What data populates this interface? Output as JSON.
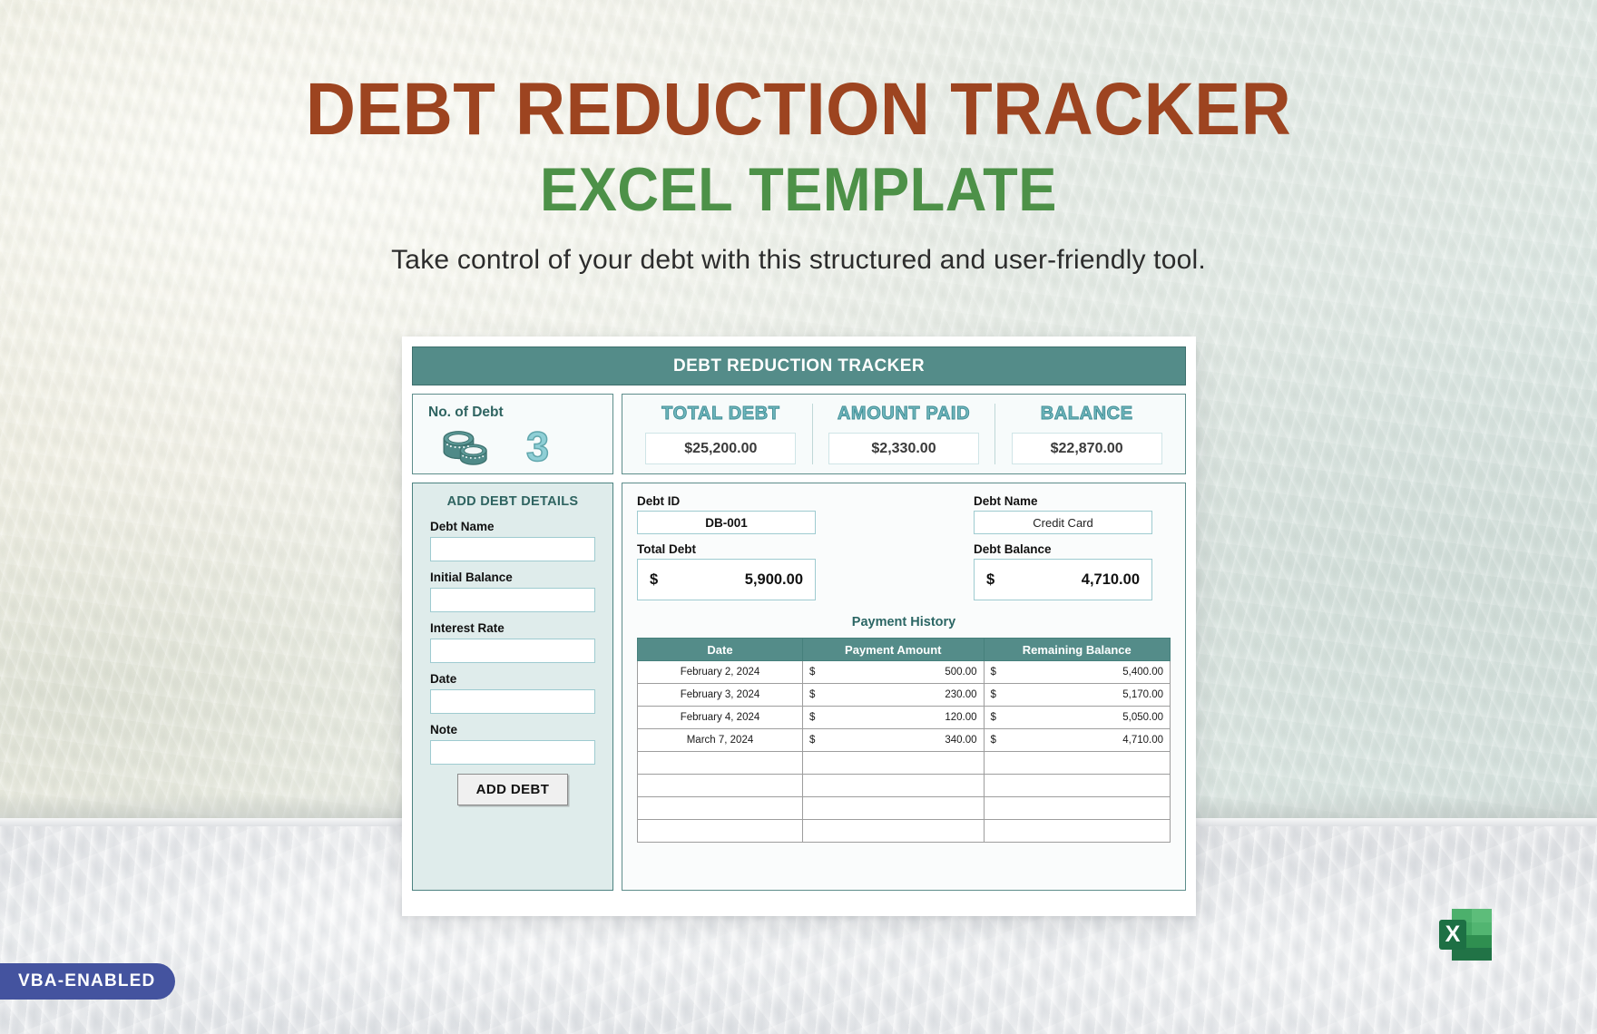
{
  "poster": {
    "title_line1": "DEBT REDUCTION TRACKER",
    "title_line2": "EXCEL TEMPLATE",
    "tagline": "Take control of your debt with this structured and user-friendly tool.",
    "vba_badge": "VBA-ENABLED",
    "colors": {
      "title_main": "#9d4420",
      "title_sub": "#4d9148",
      "sheet_header_teal": "#548c89",
      "panel_fill_light": "#f7fbfb",
      "form_panel_fill": "#dfeceb",
      "kpi_label_teal": "#6fb6bd",
      "badge_blue": "#44539f",
      "excel_green": "#217346"
    }
  },
  "sheet": {
    "header_title": "DEBT REDUCTION TRACKER",
    "count_panel": {
      "label": "No. of Debt",
      "icon": "coin-stack-icon",
      "value": "3"
    },
    "kpis": [
      {
        "label": "TOTAL DEBT",
        "value": "$25,200.00"
      },
      {
        "label": "AMOUNT PAID",
        "value": "$2,330.00"
      },
      {
        "label": "BALANCE",
        "value": "$22,870.00"
      }
    ],
    "add_form": {
      "title": "ADD DEBT DETAILS",
      "fields": [
        {
          "label": "Debt Name",
          "value": "",
          "placeholder": ""
        },
        {
          "label": "Initial Balance",
          "value": "",
          "placeholder": ""
        },
        {
          "label": "Interest Rate",
          "value": "",
          "placeholder": ""
        },
        {
          "label": "Date",
          "value": "",
          "placeholder": ""
        },
        {
          "label": "Note",
          "value": "",
          "placeholder": ""
        }
      ],
      "button_label": "ADD DEBT"
    },
    "detail": {
      "debt_id_label": "Debt ID",
      "debt_id_value": "DB-001",
      "debt_name_label": "Debt Name",
      "debt_name_value": "Credit Card",
      "total_debt_label": "Total Debt",
      "total_debt_currency": "$",
      "total_debt_value": "5,900.00",
      "debt_balance_label": "Debt Balance",
      "debt_balance_currency": "$",
      "debt_balance_value": "4,710.00"
    },
    "payment_history": {
      "title": "Payment History",
      "columns": [
        "Date",
        "Payment Amount",
        "Remaining Balance"
      ],
      "currency": "$",
      "rows": [
        {
          "date": "February 2, 2024",
          "amount": "500.00",
          "balance": "5,400.00"
        },
        {
          "date": "February 3, 2024",
          "amount": "230.00",
          "balance": "5,170.00"
        },
        {
          "date": "February 4, 2024",
          "amount": "120.00",
          "balance": "5,050.00"
        },
        {
          "date": "March 7, 2024",
          "amount": "340.00",
          "balance": "4,710.00"
        },
        {
          "date": "",
          "amount": "",
          "balance": ""
        },
        {
          "date": "",
          "amount": "",
          "balance": ""
        },
        {
          "date": "",
          "amount": "",
          "balance": ""
        },
        {
          "date": "",
          "amount": "",
          "balance": ""
        }
      ]
    }
  }
}
